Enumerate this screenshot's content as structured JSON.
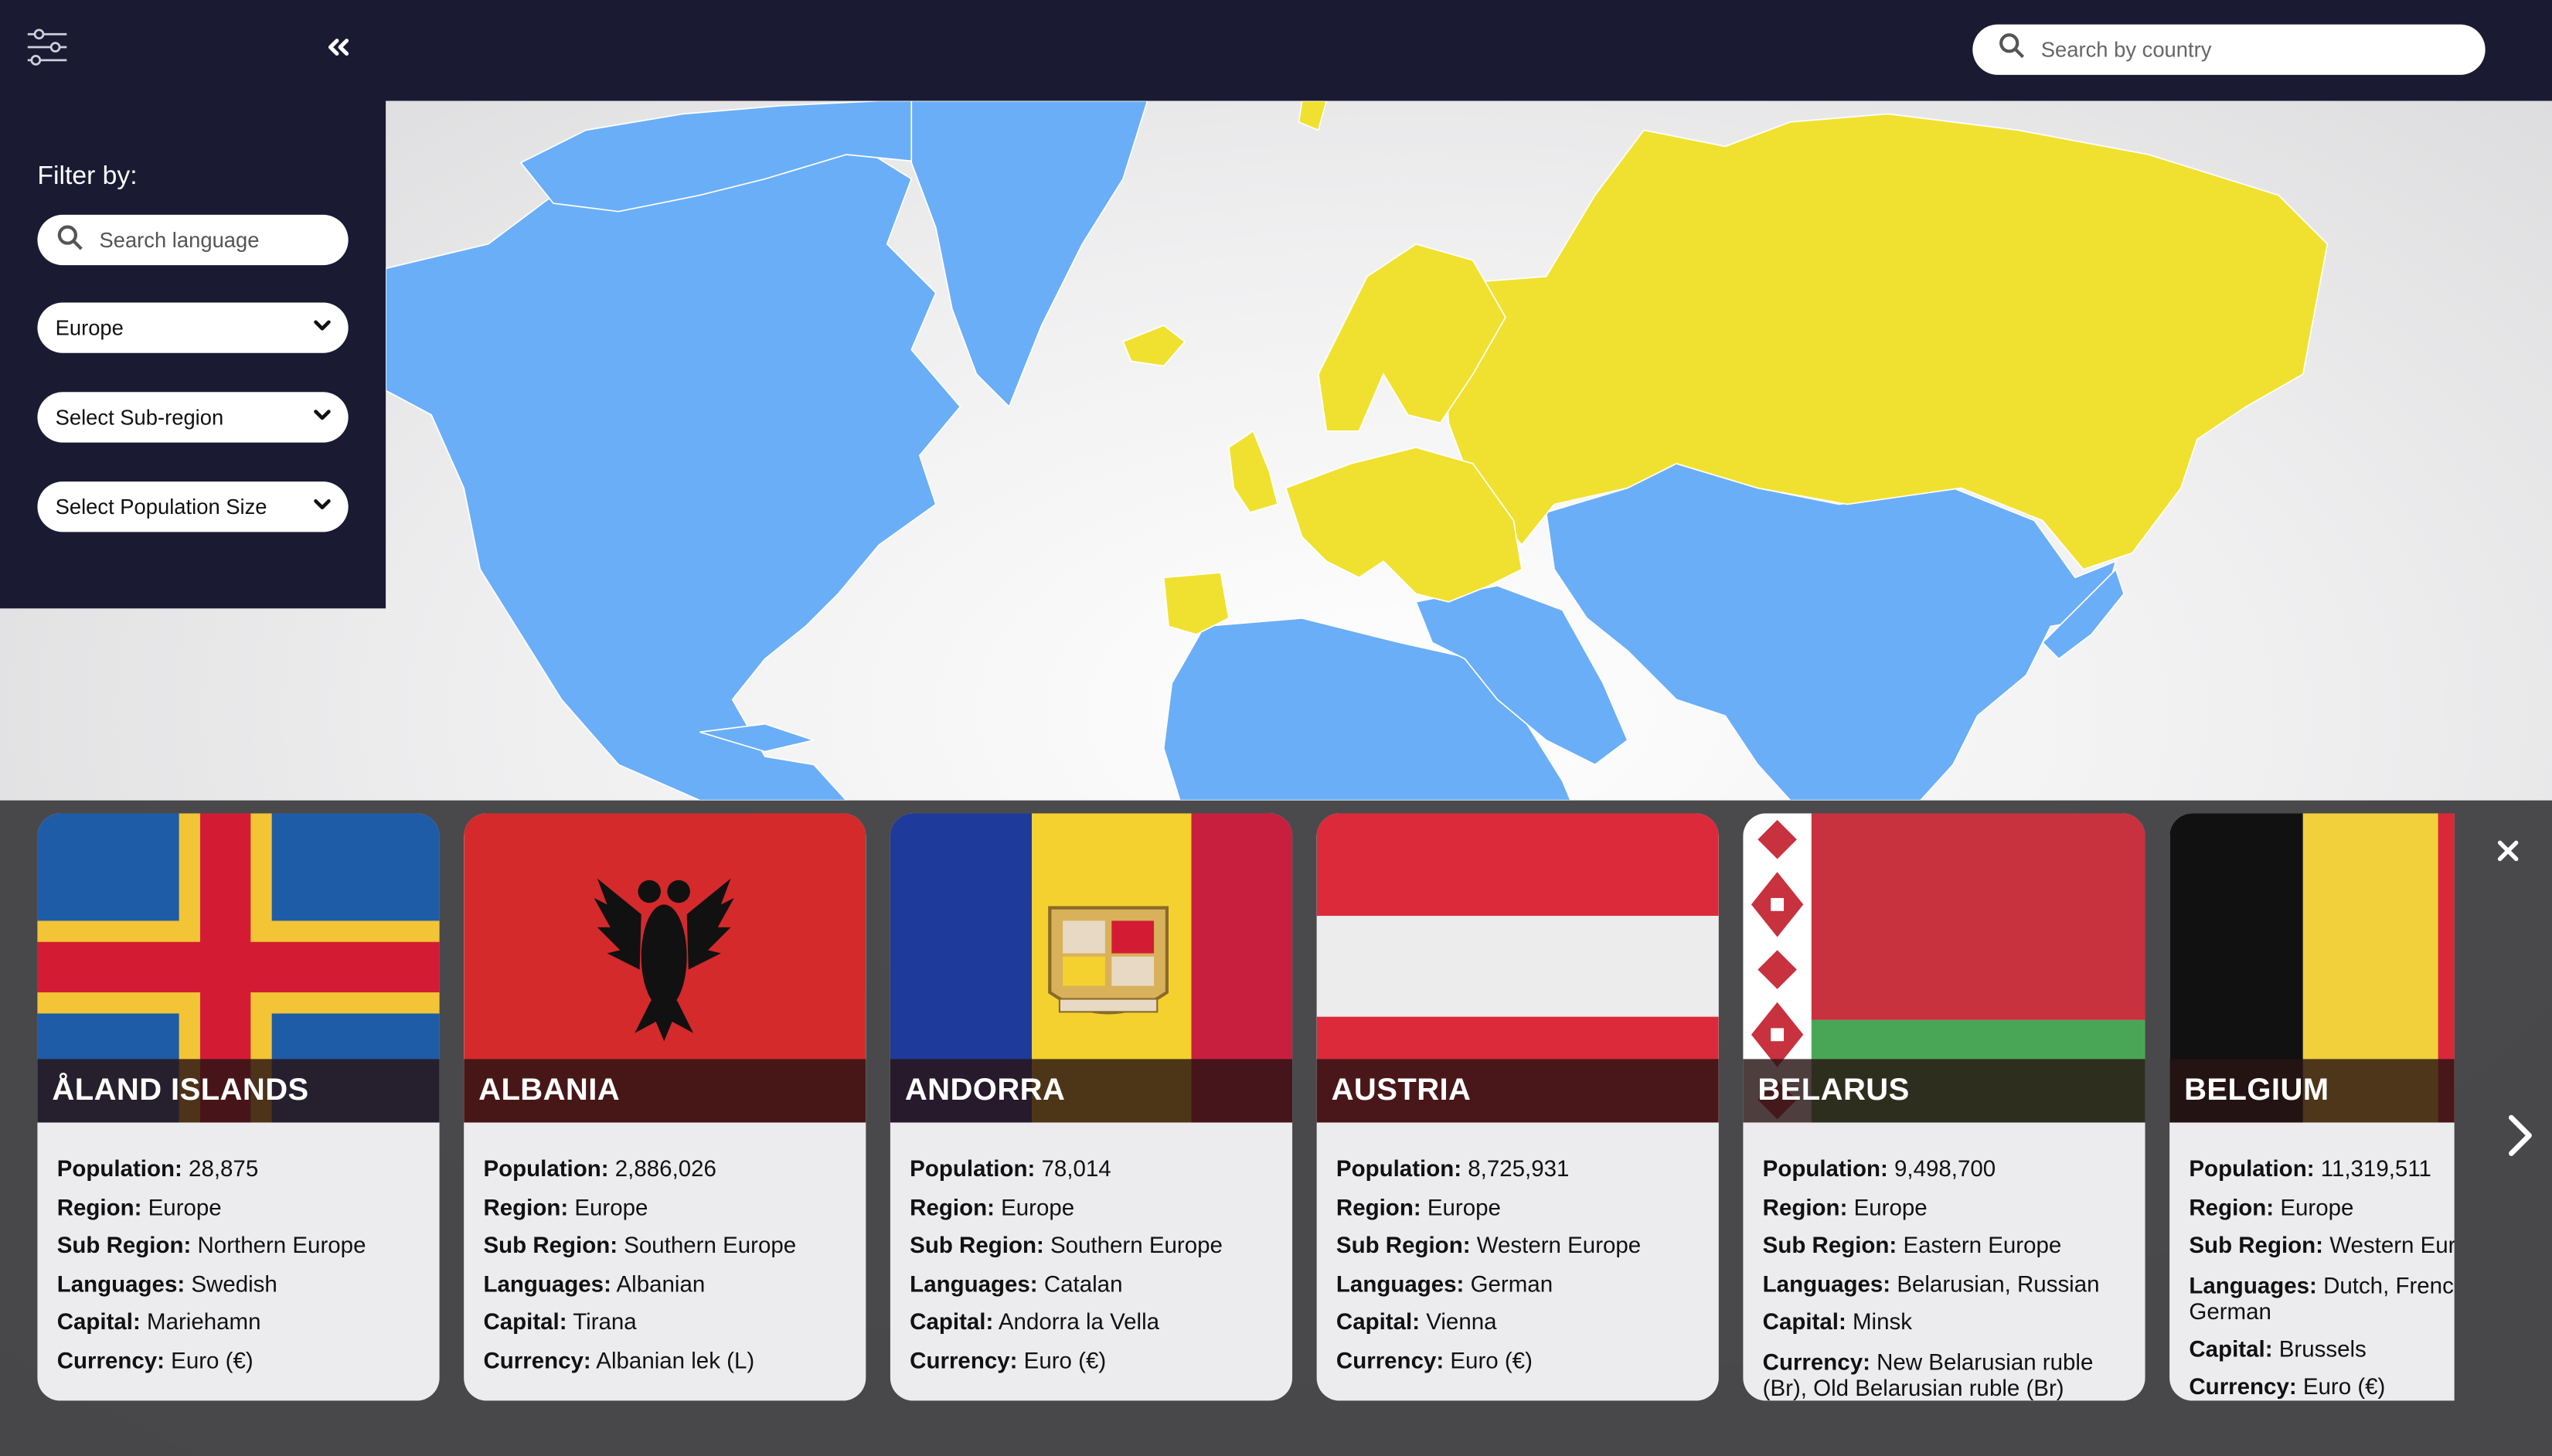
{
  "header": {
    "filter_icon": "sliders-icon",
    "collapse_icon": "double-chevron-left-icon",
    "search": {
      "icon": "search-icon",
      "placeholder": "Search by country",
      "value": ""
    }
  },
  "sidebar": {
    "title": "Filter by:",
    "language_search": {
      "icon": "search-icon",
      "placeholder": "Search language",
      "value": ""
    },
    "region_select": {
      "value": "Europe"
    },
    "subregion_select": {
      "value": "Select Sub-region"
    },
    "population_select": {
      "value": "Select Population Size"
    }
  },
  "map": {
    "highlight_color": "#f0e130",
    "default_color": "#6aaef7",
    "highlighted_region": "Europe"
  },
  "panel": {
    "close_icon": "close-icon",
    "next_icon": "chevron-right-icon",
    "labels": {
      "population": "Population:",
      "region": "Region:",
      "subregion": "Sub Region:",
      "languages": "Languages:",
      "capital": "Capital:",
      "currency": "Currency:"
    },
    "cards": [
      {
        "name": "ÅLAND ISLANDS",
        "population": "28,875",
        "region": "Europe",
        "subregion": "Northern Europe",
        "languages": "Swedish",
        "capital": "Mariehamn",
        "currency": "Euro (€)"
      },
      {
        "name": "ALBANIA",
        "population": "2,886,026",
        "region": "Europe",
        "subregion": "Southern Europe",
        "languages": "Albanian",
        "capital": "Tirana",
        "currency": "Albanian lek (L)"
      },
      {
        "name": "ANDORRA",
        "population": "78,014",
        "region": "Europe",
        "subregion": "Southern Europe",
        "languages": "Catalan",
        "capital": "Andorra la Vella",
        "currency": "Euro (€)"
      },
      {
        "name": "AUSTRIA",
        "population": "8,725,931",
        "region": "Europe",
        "subregion": "Western Europe",
        "languages": "German",
        "capital": "Vienna",
        "currency": "Euro (€)"
      },
      {
        "name": "BELARUS",
        "population": "9,498,700",
        "region": "Europe",
        "subregion": "Eastern Europe",
        "languages": "Belarusian, Russian",
        "capital": "Minsk",
        "currency": "New Belarusian ruble (Br), Old Belarusian ruble (Br)"
      },
      {
        "name": "BELGIUM",
        "population": "11,319,511",
        "region": "Europe",
        "subregion": "Western Europe",
        "languages": "Dutch, French, German",
        "capital": "Brussels",
        "currency": "Euro (€)"
      }
    ]
  }
}
